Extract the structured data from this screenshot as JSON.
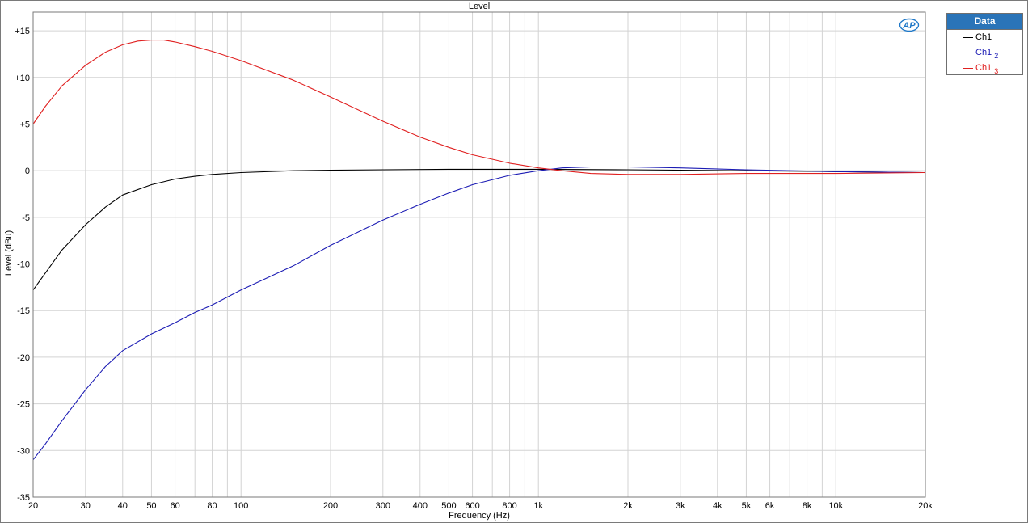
{
  "chart_data": {
    "type": "line",
    "title": "Level",
    "xlabel": "Frequency (Hz)",
    "ylabel": "Level (dBu)",
    "x_scale": "log",
    "xlim": [
      20,
      20000
    ],
    "ylim": [
      -35,
      17
    ],
    "grid": true,
    "legend_position": "right",
    "legend_title": "Data",
    "x_ticks": [
      {
        "v": 20,
        "label": "20"
      },
      {
        "v": 30,
        "label": "30"
      },
      {
        "v": 40,
        "label": "40"
      },
      {
        "v": 50,
        "label": "50"
      },
      {
        "v": 60,
        "label": "60"
      },
      {
        "v": 80,
        "label": "80"
      },
      {
        "v": 100,
        "label": "100"
      },
      {
        "v": 200,
        "label": "200"
      },
      {
        "v": 300,
        "label": "300"
      },
      {
        "v": 400,
        "label": "400"
      },
      {
        "v": 500,
        "label": "500"
      },
      {
        "v": 600,
        "label": "600"
      },
      {
        "v": 800,
        "label": "800"
      },
      {
        "v": 1000,
        "label": "1k"
      },
      {
        "v": 2000,
        "label": "2k"
      },
      {
        "v": 3000,
        "label": "3k"
      },
      {
        "v": 4000,
        "label": "4k"
      },
      {
        "v": 5000,
        "label": "5k"
      },
      {
        "v": 6000,
        "label": "6k"
      },
      {
        "v": 8000,
        "label": "8k"
      },
      {
        "v": 10000,
        "label": "10k"
      },
      {
        "v": 20000,
        "label": "20k"
      }
    ],
    "y_ticks": [
      {
        "v": 15,
        "label": "+15"
      },
      {
        "v": 10,
        "label": "+10"
      },
      {
        "v": 5,
        "label": "+5"
      },
      {
        "v": 0,
        "label": "0"
      },
      {
        "v": -5,
        "label": "-5"
      },
      {
        "v": -10,
        "label": "-10"
      },
      {
        "v": -15,
        "label": "-15"
      },
      {
        "v": -20,
        "label": "-20"
      },
      {
        "v": -25,
        "label": "-25"
      },
      {
        "v": -30,
        "label": "-30"
      },
      {
        "v": -35,
        "label": "-35"
      }
    ],
    "series": [
      {
        "name": "Ch1",
        "subscript": "",
        "color": "#000000",
        "x": [
          20,
          25,
          30,
          35,
          40,
          50,
          60,
          70,
          80,
          100,
          150,
          200,
          300,
          500,
          1000,
          2000,
          5000,
          10000,
          20000
        ],
        "y": [
          -12.8,
          -8.5,
          -5.8,
          -3.9,
          -2.6,
          -1.5,
          -0.9,
          -0.6,
          -0.4,
          -0.2,
          0.0,
          0.05,
          0.1,
          0.15,
          0.15,
          0.1,
          0.0,
          -0.1,
          -0.2
        ]
      },
      {
        "name": "Ch1",
        "subscript": "2",
        "color": "#1c1cb4",
        "x": [
          20,
          22,
          25,
          30,
          35,
          40,
          50,
          60,
          70,
          80,
          100,
          150,
          200,
          300,
          400,
          500,
          600,
          800,
          1000,
          1200,
          1500,
          2000,
          3000,
          5000,
          10000,
          20000
        ],
        "y": [
          -31.0,
          -29.3,
          -26.8,
          -23.5,
          -21.0,
          -19.3,
          -17.5,
          -16.3,
          -15.2,
          -14.4,
          -12.8,
          -10.2,
          -8.0,
          -5.3,
          -3.6,
          -2.4,
          -1.5,
          -0.5,
          0.0,
          0.3,
          0.4,
          0.4,
          0.3,
          0.1,
          -0.1,
          -0.2
        ]
      },
      {
        "name": "Ch1",
        "subscript": "3",
        "color": "#e02020",
        "x": [
          20,
          22,
          25,
          30,
          35,
          40,
          45,
          50,
          55,
          60,
          70,
          80,
          100,
          150,
          200,
          300,
          400,
          500,
          600,
          800,
          1000,
          1200,
          1500,
          2000,
          3000,
          5000,
          10000,
          20000
        ],
        "y": [
          5.0,
          6.9,
          9.1,
          11.3,
          12.7,
          13.5,
          13.9,
          14.0,
          14.0,
          13.8,
          13.3,
          12.8,
          11.8,
          9.7,
          7.9,
          5.3,
          3.6,
          2.5,
          1.7,
          0.8,
          0.3,
          0.0,
          -0.3,
          -0.4,
          -0.4,
          -0.3,
          -0.3,
          -0.2
        ]
      }
    ]
  },
  "logo": {
    "text": "AP",
    "color": "#1f78c8"
  }
}
